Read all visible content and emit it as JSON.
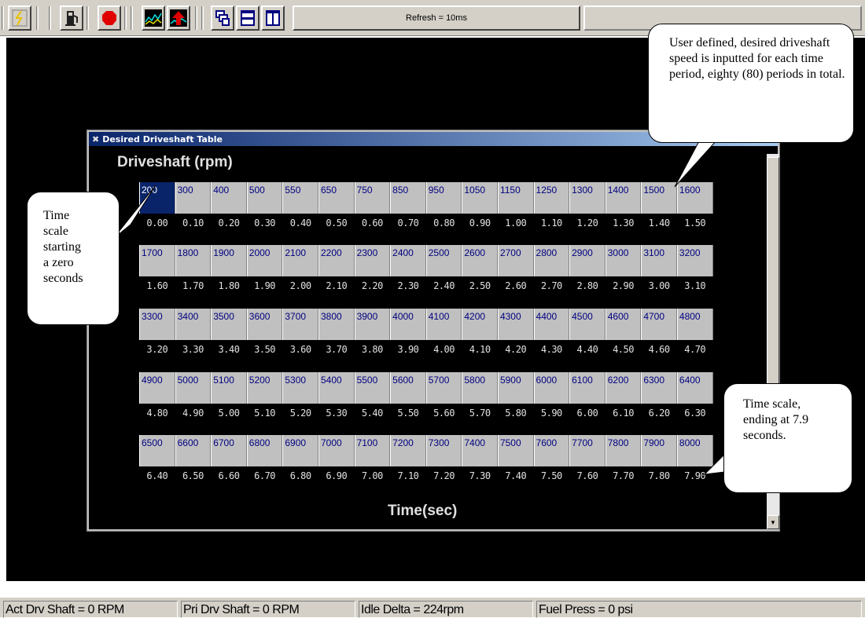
{
  "toolbar": {
    "refresh_label": "Refresh = 10ms",
    "buttons": [
      "lightning-icon",
      "fuel-pump-icon",
      "stop-icon",
      "chart-icon",
      "chart-up-arrow-icon",
      "stack-windows-icon",
      "split-horizontal-icon",
      "split-vertical-icon"
    ]
  },
  "dialog": {
    "title": "Desired Driveshaft Table",
    "heading": "Driveshaft (rpm)",
    "footer_label": "Time(sec)",
    "rows": [
      {
        "rpm": [
          "200",
          "300",
          "400",
          "500",
          "550",
          "650",
          "750",
          "850",
          "950",
          "1050",
          "1150",
          "1250",
          "1300",
          "1400",
          "1500",
          "1600"
        ],
        "time": [
          "0.00",
          "0.10",
          "0.20",
          "0.30",
          "0.40",
          "0.50",
          "0.60",
          "0.70",
          "0.80",
          "0.90",
          "1.00",
          "1.10",
          "1.20",
          "1.30",
          "1.40",
          "1.50"
        ]
      },
      {
        "rpm": [
          "1700",
          "1800",
          "1900",
          "2000",
          "2100",
          "2200",
          "2300",
          "2400",
          "2500",
          "2600",
          "2700",
          "2800",
          "2900",
          "3000",
          "3100",
          "3200"
        ],
        "time": [
          "1.60",
          "1.70",
          "1.80",
          "1.90",
          "2.00",
          "2.10",
          "2.20",
          "2.30",
          "2.40",
          "2.50",
          "2.60",
          "2.70",
          "2.80",
          "2.90",
          "3.00",
          "3.10"
        ]
      },
      {
        "rpm": [
          "3300",
          "3400",
          "3500",
          "3600",
          "3700",
          "3800",
          "3900",
          "4000",
          "4100",
          "4200",
          "4300",
          "4400",
          "4500",
          "4600",
          "4700",
          "4800"
        ],
        "time": [
          "3.20",
          "3.30",
          "3.40",
          "3.50",
          "3.60",
          "3.70",
          "3.80",
          "3.90",
          "4.00",
          "4.10",
          "4.20",
          "4.30",
          "4.40",
          "4.50",
          "4.60",
          "4.70"
        ]
      },
      {
        "rpm": [
          "4900",
          "5000",
          "5100",
          "5200",
          "5300",
          "5400",
          "5500",
          "5600",
          "5700",
          "5800",
          "5900",
          "6000",
          "6100",
          "6200",
          "6300",
          "6400"
        ],
        "time": [
          "4.80",
          "4.90",
          "5.00",
          "5.10",
          "5.20",
          "5.30",
          "5.40",
          "5.50",
          "5.60",
          "5.70",
          "5.80",
          "5.90",
          "6.00",
          "6.10",
          "6.20",
          "6.30"
        ]
      },
      {
        "rpm": [
          "6500",
          "6600",
          "6700",
          "6800",
          "6900",
          "7000",
          "7100",
          "7200",
          "7300",
          "7400",
          "7500",
          "7600",
          "7700",
          "7800",
          "7900",
          "8000"
        ],
        "time": [
          "6.40",
          "6.50",
          "6.60",
          "6.70",
          "6.80",
          "6.90",
          "7.00",
          "7.10",
          "7.20",
          "7.30",
          "7.40",
          "7.50",
          "7.60",
          "7.70",
          "7.80",
          "7.90"
        ]
      }
    ]
  },
  "callouts": {
    "top_right": "User defined, desired driveshaft speed is inputted for each time period, eighty (80) periods in total.",
    "left": "Time scale starting a zero seconds",
    "bottom_right": "Time scale, ending at 7.9 seconds."
  },
  "statusbar": {
    "act_drv_shaft": "Act Drv Shaft = 0 RPM",
    "pri_drv_shaft": "Pri Drv Shaft = 0 RPM",
    "idle_delta": "Idle Delta = 224rpm",
    "fuel_press": "Fuel Press = 0 psi"
  }
}
